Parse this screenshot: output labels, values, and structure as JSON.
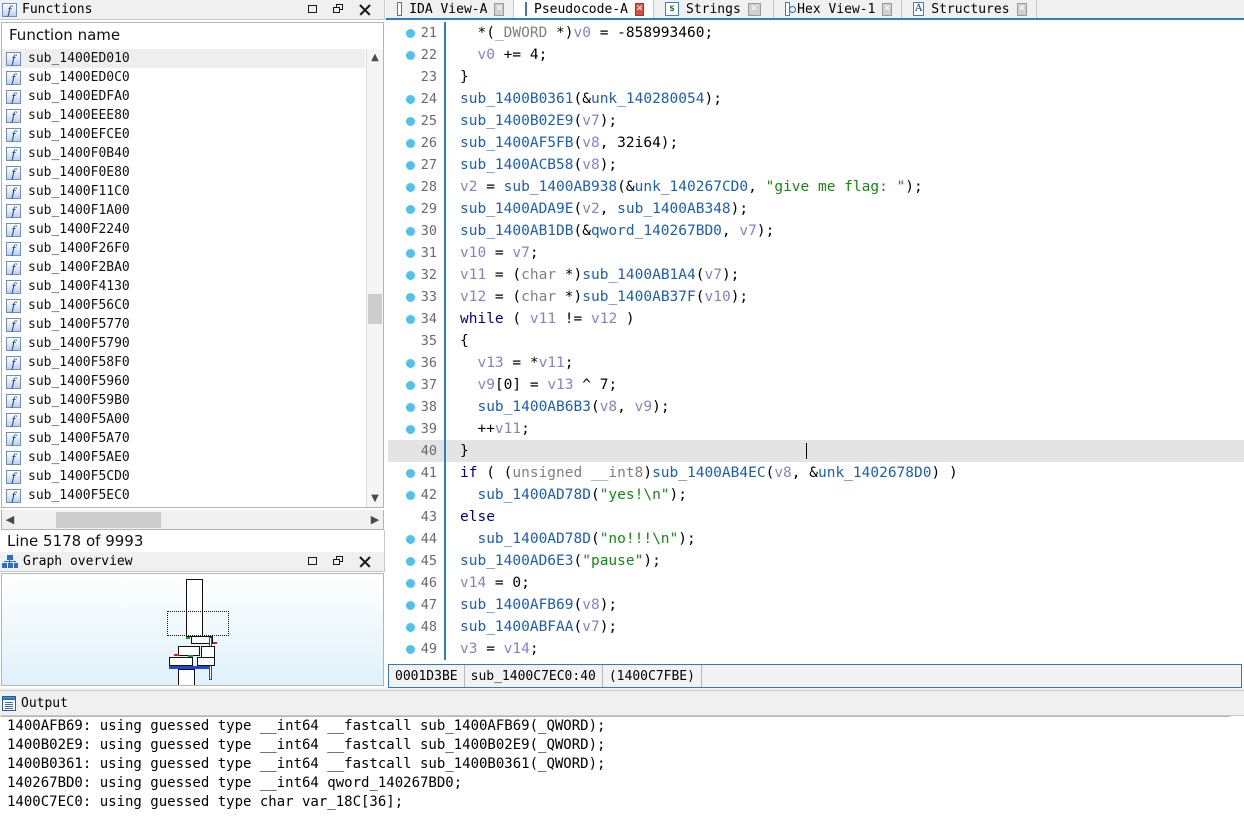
{
  "functions_panel": {
    "title": "Functions",
    "column_header": "Function name",
    "icon": "function-icon",
    "status": "Line 5178 of 9993",
    "rows": [
      {
        "name": "sub_1400ED010",
        "selected": true
      },
      {
        "name": "sub_1400ED0C0",
        "selected": false
      },
      {
        "name": "sub_1400EDFA0",
        "selected": false
      },
      {
        "name": "sub_1400EEE80",
        "selected": false
      },
      {
        "name": "sub_1400EFCE0",
        "selected": false
      },
      {
        "name": "sub_1400F0B40",
        "selected": false
      },
      {
        "name": "sub_1400F0E80",
        "selected": false
      },
      {
        "name": "sub_1400F11C0",
        "selected": false
      },
      {
        "name": "sub_1400F1A00",
        "selected": false
      },
      {
        "name": "sub_1400F2240",
        "selected": false
      },
      {
        "name": "sub_1400F26F0",
        "selected": false
      },
      {
        "name": "sub_1400F2BA0",
        "selected": false
      },
      {
        "name": "sub_1400F4130",
        "selected": false
      },
      {
        "name": "sub_1400F56C0",
        "selected": false
      },
      {
        "name": "sub_1400F5770",
        "selected": false
      },
      {
        "name": "sub_1400F5790",
        "selected": false
      },
      {
        "name": "sub_1400F58F0",
        "selected": false
      },
      {
        "name": "sub_1400F5960",
        "selected": false
      },
      {
        "name": "sub_1400F59B0",
        "selected": false
      },
      {
        "name": "sub_1400F5A00",
        "selected": false
      },
      {
        "name": "sub_1400F5A70",
        "selected": false
      },
      {
        "name": "sub_1400F5AE0",
        "selected": false
      },
      {
        "name": "sub_1400F5CD0",
        "selected": false
      },
      {
        "name": "sub_1400F5EC0",
        "selected": false
      }
    ]
  },
  "graph_panel": {
    "title": "Graph overview",
    "icon": "graph-icon"
  },
  "tabs": [
    {
      "label": "IDA View-A",
      "icon": "document-icon",
      "active": false,
      "closable": true
    },
    {
      "label": "Pseudocode-A",
      "icon": "document-icon",
      "active": true,
      "closable": true
    },
    {
      "label": "Strings",
      "icon": "strings-icon",
      "active": false,
      "closable": true
    },
    {
      "label": "Hex View-1",
      "icon": "hexview-icon",
      "active": false,
      "closable": true
    },
    {
      "label": "Structures",
      "icon": "structures-icon",
      "active": false,
      "closable": true
    }
  ],
  "pseudocode": {
    "highlighted_line": 40,
    "lines": [
      {
        "no": "21",
        "marker": true,
        "tokens": [
          {
            "t": "n",
            "x": "  *("
          },
          {
            "t": "t",
            "x": "_DWORD "
          },
          {
            "t": "n",
            "x": "*)"
          },
          {
            "t": "v",
            "x": "v0"
          },
          {
            "t": "n",
            "x": " = -858993460;"
          }
        ]
      },
      {
        "no": "22",
        "marker": true,
        "tokens": [
          {
            "t": "n",
            "x": "  "
          },
          {
            "t": "v",
            "x": "v0"
          },
          {
            "t": "n",
            "x": " += 4;"
          }
        ]
      },
      {
        "no": "23",
        "marker": false,
        "tokens": [
          {
            "t": "n",
            "x": "}"
          }
        ]
      },
      {
        "no": "24",
        "marker": true,
        "tokens": [
          {
            "t": "f",
            "x": "sub_1400B0361"
          },
          {
            "t": "n",
            "x": "(&"
          },
          {
            "t": "f",
            "x": "unk_140280054"
          },
          {
            "t": "n",
            "x": ");"
          }
        ]
      },
      {
        "no": "25",
        "marker": true,
        "tokens": [
          {
            "t": "f",
            "x": "sub_1400B02E9"
          },
          {
            "t": "n",
            "x": "("
          },
          {
            "t": "v",
            "x": "v7"
          },
          {
            "t": "n",
            "x": ");"
          }
        ]
      },
      {
        "no": "26",
        "marker": true,
        "tokens": [
          {
            "t": "f",
            "x": "sub_1400AF5FB"
          },
          {
            "t": "n",
            "x": "("
          },
          {
            "t": "v",
            "x": "v8"
          },
          {
            "t": "n",
            "x": ", 32i64);"
          }
        ]
      },
      {
        "no": "27",
        "marker": true,
        "tokens": [
          {
            "t": "f",
            "x": "sub_1400ACB58"
          },
          {
            "t": "n",
            "x": "("
          },
          {
            "t": "v",
            "x": "v8"
          },
          {
            "t": "n",
            "x": ");"
          }
        ]
      },
      {
        "no": "28",
        "marker": true,
        "tokens": [
          {
            "t": "v",
            "x": "v2"
          },
          {
            "t": "n",
            "x": " = "
          },
          {
            "t": "f",
            "x": "sub_1400AB938"
          },
          {
            "t": "n",
            "x": "(&"
          },
          {
            "t": "f",
            "x": "unk_140267CD0"
          },
          {
            "t": "n",
            "x": ", "
          },
          {
            "t": "s",
            "x": "\"give me flag: \""
          },
          {
            "t": "n",
            "x": ");"
          }
        ]
      },
      {
        "no": "29",
        "marker": true,
        "tokens": [
          {
            "t": "f",
            "x": "sub_1400ADA9E"
          },
          {
            "t": "n",
            "x": "("
          },
          {
            "t": "v",
            "x": "v2"
          },
          {
            "t": "n",
            "x": ", "
          },
          {
            "t": "f",
            "x": "sub_1400AB348"
          },
          {
            "t": "n",
            "x": ");"
          }
        ]
      },
      {
        "no": "30",
        "marker": true,
        "tokens": [
          {
            "t": "f",
            "x": "sub_1400AB1DB"
          },
          {
            "t": "n",
            "x": "(&"
          },
          {
            "t": "f",
            "x": "qword_140267BD0"
          },
          {
            "t": "n",
            "x": ", "
          },
          {
            "t": "v",
            "x": "v7"
          },
          {
            "t": "n",
            "x": ");"
          }
        ]
      },
      {
        "no": "31",
        "marker": true,
        "tokens": [
          {
            "t": "v",
            "x": "v10"
          },
          {
            "t": "n",
            "x": " = "
          },
          {
            "t": "v",
            "x": "v7"
          },
          {
            "t": "n",
            "x": ";"
          }
        ]
      },
      {
        "no": "32",
        "marker": true,
        "tokens": [
          {
            "t": "v",
            "x": "v11"
          },
          {
            "t": "n",
            "x": " = ("
          },
          {
            "t": "t",
            "x": "char "
          },
          {
            "t": "n",
            "x": "*)"
          },
          {
            "t": "f",
            "x": "sub_1400AB1A4"
          },
          {
            "t": "n",
            "x": "("
          },
          {
            "t": "v",
            "x": "v7"
          },
          {
            "t": "n",
            "x": ");"
          }
        ]
      },
      {
        "no": "33",
        "marker": true,
        "tokens": [
          {
            "t": "v",
            "x": "v12"
          },
          {
            "t": "n",
            "x": " = ("
          },
          {
            "t": "t",
            "x": "char "
          },
          {
            "t": "n",
            "x": "*)"
          },
          {
            "t": "f",
            "x": "sub_1400AB37F"
          },
          {
            "t": "n",
            "x": "("
          },
          {
            "t": "v",
            "x": "v10"
          },
          {
            "t": "n",
            "x": ");"
          }
        ]
      },
      {
        "no": "34",
        "marker": true,
        "tokens": [
          {
            "t": "k",
            "x": "while"
          },
          {
            "t": "n",
            "x": " ( "
          },
          {
            "t": "v",
            "x": "v11"
          },
          {
            "t": "n",
            "x": " != "
          },
          {
            "t": "v",
            "x": "v12"
          },
          {
            "t": "n",
            "x": " )"
          }
        ]
      },
      {
        "no": "35",
        "marker": false,
        "tokens": [
          {
            "t": "n",
            "x": "{"
          }
        ]
      },
      {
        "no": "36",
        "marker": true,
        "tokens": [
          {
            "t": "n",
            "x": "  "
          },
          {
            "t": "v",
            "x": "v13"
          },
          {
            "t": "n",
            "x": " = *"
          },
          {
            "t": "v",
            "x": "v11"
          },
          {
            "t": "n",
            "x": ";"
          }
        ]
      },
      {
        "no": "37",
        "marker": true,
        "tokens": [
          {
            "t": "n",
            "x": "  "
          },
          {
            "t": "v",
            "x": "v9"
          },
          {
            "t": "n",
            "x": "[0] = "
          },
          {
            "t": "v",
            "x": "v13"
          },
          {
            "t": "n",
            "x": " ^ 7;"
          }
        ]
      },
      {
        "no": "38",
        "marker": true,
        "tokens": [
          {
            "t": "n",
            "x": "  "
          },
          {
            "t": "f",
            "x": "sub_1400AB6B3"
          },
          {
            "t": "n",
            "x": "("
          },
          {
            "t": "v",
            "x": "v8"
          },
          {
            "t": "n",
            "x": ", "
          },
          {
            "t": "v",
            "x": "v9"
          },
          {
            "t": "n",
            "x": ");"
          }
        ]
      },
      {
        "no": "39",
        "marker": true,
        "tokens": [
          {
            "t": "n",
            "x": "  ++"
          },
          {
            "t": "v",
            "x": "v11"
          },
          {
            "t": "n",
            "x": ";"
          }
        ]
      },
      {
        "no": "40",
        "marker": false,
        "tokens": [
          {
            "t": "n",
            "x": "}"
          }
        ]
      },
      {
        "no": "41",
        "marker": true,
        "tokens": [
          {
            "t": "k",
            "x": "if"
          },
          {
            "t": "n",
            "x": " ( ("
          },
          {
            "t": "t",
            "x": "unsigned __int8"
          },
          {
            "t": "n",
            "x": ")"
          },
          {
            "t": "f",
            "x": "sub_1400AB4EC"
          },
          {
            "t": "n",
            "x": "("
          },
          {
            "t": "v",
            "x": "v8"
          },
          {
            "t": "n",
            "x": ", &"
          },
          {
            "t": "f",
            "x": "unk_1402678D0"
          },
          {
            "t": "n",
            "x": ") )"
          }
        ]
      },
      {
        "no": "42",
        "marker": true,
        "tokens": [
          {
            "t": "n",
            "x": "  "
          },
          {
            "t": "f",
            "x": "sub_1400AD78D"
          },
          {
            "t": "n",
            "x": "("
          },
          {
            "t": "s",
            "x": "\"yes!\\n\""
          },
          {
            "t": "n",
            "x": ");"
          }
        ]
      },
      {
        "no": "43",
        "marker": false,
        "tokens": [
          {
            "t": "k",
            "x": "else"
          }
        ]
      },
      {
        "no": "44",
        "marker": true,
        "tokens": [
          {
            "t": "n",
            "x": "  "
          },
          {
            "t": "f",
            "x": "sub_1400AD78D"
          },
          {
            "t": "n",
            "x": "("
          },
          {
            "t": "s",
            "x": "\"no!!!\\n\""
          },
          {
            "t": "n",
            "x": ");"
          }
        ]
      },
      {
        "no": "45",
        "marker": true,
        "tokens": [
          {
            "t": "f",
            "x": "sub_1400AD6E3"
          },
          {
            "t": "n",
            "x": "("
          },
          {
            "t": "s",
            "x": "\"pause\""
          },
          {
            "t": "n",
            "x": ");"
          }
        ]
      },
      {
        "no": "46",
        "marker": true,
        "tokens": [
          {
            "t": "v",
            "x": "v14"
          },
          {
            "t": "n",
            "x": " = 0;"
          }
        ]
      },
      {
        "no": "47",
        "marker": true,
        "tokens": [
          {
            "t": "f",
            "x": "sub_1400AFB69"
          },
          {
            "t": "n",
            "x": "("
          },
          {
            "t": "v",
            "x": "v8"
          },
          {
            "t": "n",
            "x": ");"
          }
        ]
      },
      {
        "no": "48",
        "marker": true,
        "tokens": [
          {
            "t": "f",
            "x": "sub_1400ABFAA"
          },
          {
            "t": "n",
            "x": "("
          },
          {
            "t": "v",
            "x": "v7"
          },
          {
            "t": "n",
            "x": ");"
          }
        ]
      },
      {
        "no": "49",
        "marker": true,
        "tokens": [
          {
            "t": "v",
            "x": "v3"
          },
          {
            "t": "n",
            "x": " = "
          },
          {
            "t": "v",
            "x": "v14"
          },
          {
            "t": "n",
            "x": ";"
          }
        ]
      }
    ],
    "status_bar": {
      "offset": "0001D3BE",
      "location": "sub_1400C7EC0:40",
      "address": "(1400C7FBE)"
    }
  },
  "output_panel": {
    "title": "Output",
    "icon": "output-icon",
    "lines": [
      "1400AFB69: using guessed type __int64 __fastcall sub_1400AFB69(_QWORD);",
      "1400B02E9: using guessed type __int64 __fastcall sub_1400B02E9(_QWORD);",
      "1400B0361: using guessed type __int64 __fastcall sub_1400B0361(_QWORD);",
      "140267BD0: using guessed type __int64 qword_140267BD0;",
      "1400C7EC0: using guessed type char var_18C[36];"
    ]
  },
  "colors": {
    "accent_blue": "#2d7ec0",
    "marker_dot": "#4cc3ec",
    "keyword": "#00008b",
    "function": "#1b5eb5",
    "variable": "#8a7ecb",
    "string": "#118a11",
    "type": "#808080",
    "highlight_row": "#e4e4e4"
  },
  "window_buttons": [
    "restore",
    "float",
    "close"
  ]
}
